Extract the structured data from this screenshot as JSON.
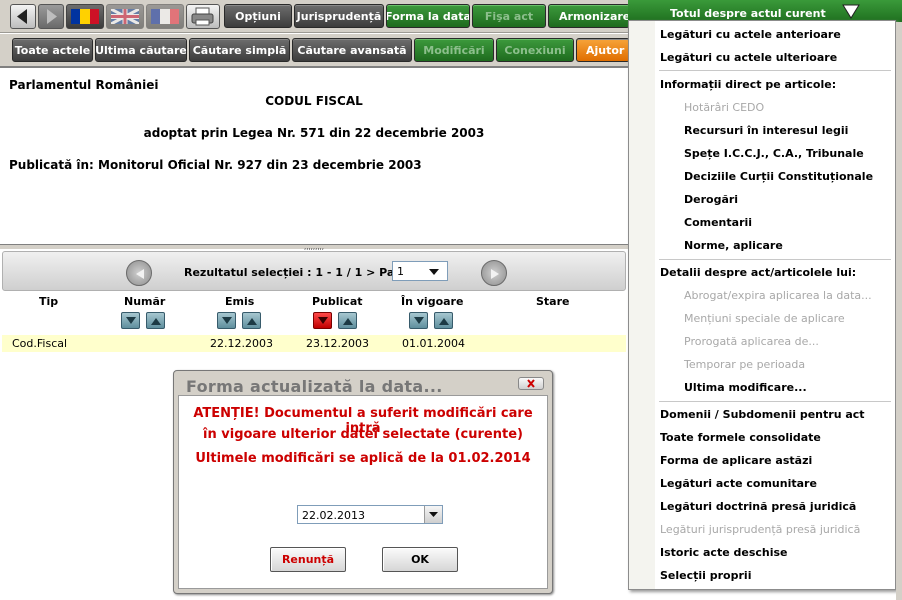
{
  "toolbar1": {
    "optiuni": "Opțiuni",
    "jurisprudenta": "Jurisprudență",
    "forma_la_data": "Forma la data",
    "fisa_act": "Fişa act",
    "armonizare": "Armonizare"
  },
  "toolbar2": {
    "toate_actele": "Toate actele",
    "ultima_cautare": "Ultima căutare",
    "cautare_simpla": "Căutare simplă",
    "cautare_avansata": "Căutare avansată",
    "modificari": "Modificări",
    "conexiuni": "Conexiuni",
    "ajutor": "Ajutor"
  },
  "document": {
    "issuer": "Parlamentul României",
    "title": "CODUL FISCAL",
    "adopted": "adoptat prin Legea Nr. 571 din 22 decembrie 2003",
    "published": "Publicată în: Monitorul Oficial Nr. 927 din 23 decembrie 2003"
  },
  "pager": {
    "label": "Rezultatul selecției : 1 - 1 / 1 > Pag:",
    "page": "1"
  },
  "table": {
    "headers": [
      "Tip",
      "Număr",
      "Emis",
      "Publicat",
      "În vigoare",
      "Stare"
    ],
    "rows": [
      {
        "tip": "Cod.Fiscal",
        "numar": "",
        "emis": "22.12.2003",
        "publicat": "23.12.2003",
        "in_vigoare": "01.01.2004",
        "stare": ""
      }
    ]
  },
  "dialog": {
    "title": "Forma actualizată la data...",
    "line1": "ATENȚIE! Documentul a suferit modificări care intră",
    "line2": "în vigoare ulterior datei selectate (curente)",
    "line3": "Ultimele modificări se aplică de la 01.02.2014",
    "date": "22.02.2013",
    "cancel": "Renunță",
    "ok": "OK"
  },
  "menu": {
    "header": "Totul despre actul curent",
    "items": [
      {
        "label": "Legături cu actele anterioare",
        "enabled": true
      },
      {
        "label": "Legături cu actele ulterioare",
        "enabled": true
      },
      {
        "label": "Informații direct pe articole:",
        "enabled": true
      },
      {
        "label": "Hotărâri CEDO",
        "enabled": false
      },
      {
        "label": "Recursuri în interesul legii",
        "enabled": true
      },
      {
        "label": "Spețe I.C.C.J., C.A., Tribunale",
        "enabled": true
      },
      {
        "label": "Deciziile Curții Constituționale",
        "enabled": true
      },
      {
        "label": "Derogări",
        "enabled": true
      },
      {
        "label": "Comentarii",
        "enabled": true
      },
      {
        "label": "Norme, aplicare",
        "enabled": true
      },
      {
        "label": "Detalii despre act/articolele lui:",
        "enabled": true
      },
      {
        "label": "Abrogat/expira aplicarea la data...",
        "enabled": false
      },
      {
        "label": "Mențiuni speciale de aplicare",
        "enabled": false
      },
      {
        "label": "Prorogată aplicarea de...",
        "enabled": false
      },
      {
        "label": "Temporar pe perioada",
        "enabled": false
      },
      {
        "label": "Ultima modificare...",
        "enabled": true
      },
      {
        "label": "Domenii / Subdomenii pentru act",
        "enabled": true
      },
      {
        "label": "Toate formele consolidate",
        "enabled": true
      },
      {
        "label": "Forma de aplicare astăzi",
        "enabled": true
      },
      {
        "label": "Legături acte comunitare",
        "enabled": true
      },
      {
        "label": "Legături doctrină presă juridică",
        "enabled": true
      },
      {
        "label": "Legături jurisprudență presă juridică",
        "enabled": false
      },
      {
        "label": "Istoric acte deschise",
        "enabled": true
      },
      {
        "label": "Selecții proprii",
        "enabled": true
      }
    ]
  },
  "colors": {
    "accent_green": "#2e8b2e",
    "warning_red": "#cc0000",
    "selected_row": "#ffffcc",
    "ajutor_orange": "#f08a1a"
  },
  "icons": [
    "back-arrow-icon",
    "forward-arrow-icon",
    "romanian-flag-icon",
    "uk-flag-icon",
    "french-flag-icon",
    "print-icon",
    "dropdown-arrow-icon",
    "close-icon",
    "sort-asc-icon",
    "sort-desc-icon"
  ]
}
